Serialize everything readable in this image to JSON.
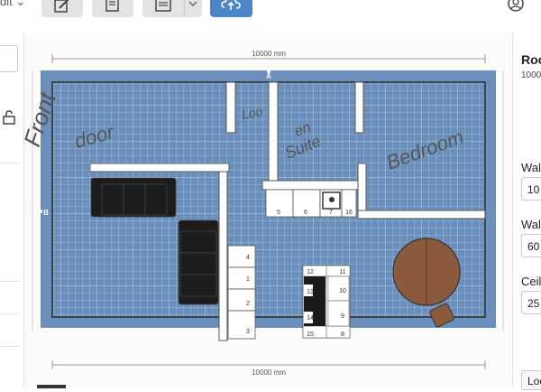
{
  "toolbar": {
    "edit_label": "dit",
    "buttons": [
      "edit-icon",
      "notes-icon",
      "print-icon",
      "chevron-down-icon",
      "cloud-upload-icon"
    ]
  },
  "user_icon": "user-circle-icon",
  "floorplan": {
    "dimension_top": "10000 mm",
    "dimension_bottom": "10000 mm",
    "wall_label_top": "A",
    "wall_label_left": "B",
    "handwriting": {
      "front_door": [
        "Front",
        "door"
      ],
      "loo": "Loo",
      "ensuite": [
        "en",
        "Suite"
      ],
      "bedroom": "Bedroom"
    },
    "cabinet_numbers": [
      "5",
      "6",
      "7",
      "16",
      "4",
      "1",
      "2",
      "3",
      "12",
      "11",
      "13",
      "10",
      "14",
      "9",
      "15",
      "8"
    ]
  },
  "right_panel": {
    "title": "Roo",
    "subtitle": "1000",
    "wall_label_1": "Wal",
    "wall_value_1": "10",
    "wall_label_2": "Wal",
    "wall_value_2": "60",
    "ceiling_label": "Ceil",
    "ceiling_value": "25",
    "bottom_button": "Loc"
  },
  "colors": {
    "wall_blue": "#6b8fbb",
    "accent_blue": "#4a86c8",
    "table_brown": "#8b5a3c",
    "sofa_black": "#1c1c1c"
  }
}
